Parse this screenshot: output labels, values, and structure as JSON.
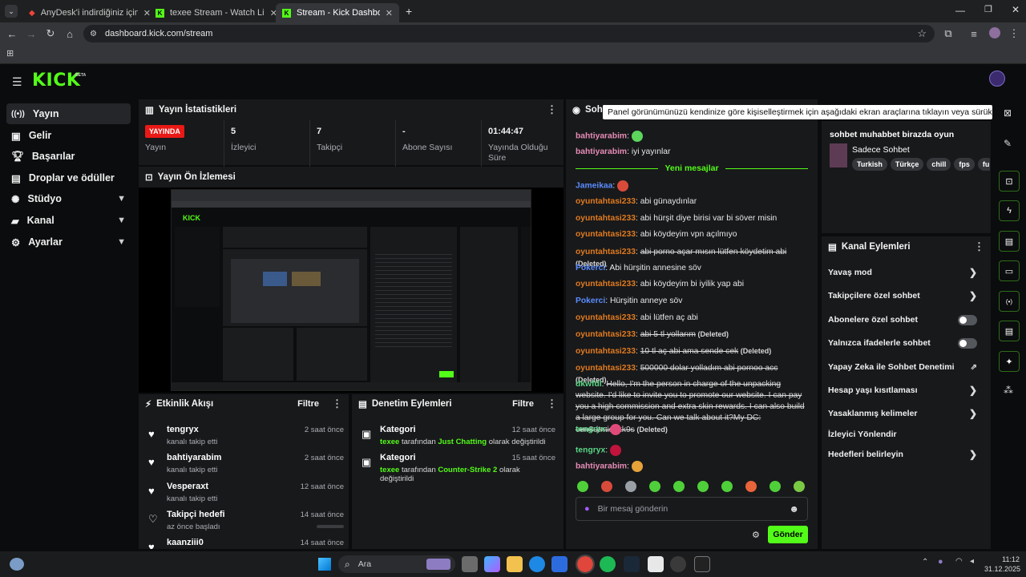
{
  "browser": {
    "tabs": [
      {
        "title": "AnyDesk'i indirdiğiniz için teşekk",
        "active": false
      },
      {
        "title": "texee Stream - Watch Live on Ki",
        "active": false
      },
      {
        "title": "Stream - Kick Dashboard",
        "active": true
      }
    ],
    "url": "dashboard.kick.com/stream"
  },
  "header": {
    "logo": "KICK",
    "beta": "BETA"
  },
  "sidebar": {
    "items": [
      {
        "label": "Yayın",
        "icon": "broadcast-icon",
        "active": true
      },
      {
        "label": "Gelir",
        "icon": "revenue-icon"
      },
      {
        "label": "Başarılar",
        "icon": "trophy-icon"
      },
      {
        "label": "Droplar ve ödüller",
        "icon": "gift-icon"
      },
      {
        "label": "Stüdyo",
        "icon": "studio-icon",
        "expand": true
      },
      {
        "label": "Kanal",
        "icon": "channel-icon",
        "expand": true
      },
      {
        "label": "Ayarlar",
        "icon": "settings-icon",
        "expand": true
      }
    ]
  },
  "stats": {
    "title": "Yayın İstatistikleri",
    "badge": "YAYINDA",
    "items": [
      {
        "label": "Yayın",
        "value": ""
      },
      {
        "label": "İzleyici",
        "value": "5"
      },
      {
        "label": "Takipçi",
        "value": "7"
      },
      {
        "label": "Abone Sayısı",
        "value": "-"
      },
      {
        "label": "Yayında Olduğu Süre",
        "value": "01:44:47"
      }
    ]
  },
  "preview": {
    "title": "Yayın Ön İzlemesi"
  },
  "activity": {
    "title": "Etkinlik Akışı",
    "filter": "Filtre",
    "items": [
      {
        "name": "tengryx",
        "desc": "kanalı takip etti",
        "time": "2 saat önce",
        "icon": "heart"
      },
      {
        "name": "bahtiyarabim",
        "desc": "kanalı takip etti",
        "time": "2 saat önce",
        "icon": "heart"
      },
      {
        "name": "Vesperaxt",
        "desc": "kanalı takip etti",
        "time": "12 saat önce",
        "icon": "heart"
      },
      {
        "name": "Takipçi hedefi",
        "desc": "az önce başladı",
        "time": "14 saat önce",
        "icon": "heart-outline"
      },
      {
        "name": "kaanziii0",
        "desc": "",
        "time": "14 saat önce",
        "icon": "heart"
      }
    ]
  },
  "moderation": {
    "title": "Denetim Eylemleri",
    "filter": "Filtre",
    "items": [
      {
        "title": "Kategori",
        "time": "12 saat önce",
        "user": "texee",
        "mid": "tarafından",
        "cat": "Just Chatting",
        "end": "olarak değiştirildi"
      },
      {
        "title": "Kategori",
        "time": "15 saat önce",
        "user": "texee",
        "mid": "tarafından",
        "cat": "Counter-Strike 2",
        "end": "olarak değiştirildi"
      }
    ]
  },
  "chat": {
    "title": "Sohbet",
    "tooltip": "Panel görünümünüzü kendinize göre kişiselleştirmek için aşağıdaki ekran araçlarına tıklayın veya sürükleyin",
    "new_messages": "Yeni mesajlar",
    "deleted": "(Deleted)",
    "messages": [
      {
        "user": "bahtiyarabim",
        "cls": "u-bh",
        "text": "",
        "emote": "#5cd65c"
      },
      {
        "user": "bahtiyarabim",
        "cls": "u-bh",
        "text": "iyi yayınlar"
      },
      {
        "user": "Jameikaa",
        "cls": "u-bl",
        "text": "",
        "emote": "#d84b3a"
      },
      {
        "user": "oyuntahtasi233",
        "cls": "u-or",
        "text": "abi günaydınlar"
      },
      {
        "user": "oyuntahtasi233",
        "cls": "u-or",
        "text": "abi hürşit diye birisi var bi söver misin"
      },
      {
        "user": "oyuntahtasi233",
        "cls": "u-or",
        "text": "abi köydeyim vpn açılmıyo"
      },
      {
        "user": "oyuntahtasi233",
        "cls": "u-or",
        "text": "abi porno açar mısın lütfen köydetim abi",
        "deleted": true
      },
      {
        "user": "Pokerci",
        "cls": "u-bl",
        "text": "Abi hürşitin annesine söv"
      },
      {
        "user": "oyuntahtasi233",
        "cls": "u-or",
        "text": "abi köydeyim bi iyilik yap abi"
      },
      {
        "user": "Pokerci",
        "cls": "u-bl",
        "text": "Hürşitin anneye söv"
      },
      {
        "user": "oyuntahtasi233",
        "cls": "u-or",
        "text": "abi lütfen aç abi"
      },
      {
        "user": "oyuntahtasi233",
        "cls": "u-or",
        "text": "abi 5 tl yollarım",
        "deleted": true
      },
      {
        "user": "oyuntahtasi233",
        "cls": "u-or",
        "text": "10 tl aç abi ama sende cek",
        "deleted": true
      },
      {
        "user": "oyuntahtasi233",
        "cls": "u-or",
        "text": "500000 dolar yolladım abi pornoo acc",
        "deleted": true
      },
      {
        "user": "dkwfdl",
        "cls": "u-gr",
        "text": "Hello, I'm the person in charge of the unpacking website. I'd like to invite you to promote our website. I can pay you a high commission and extra skin rewards. I can also build a large group for you. Can we talk about it?My DC: cen8dtmis9kk9s",
        "deleted": true
      },
      {
        "user": "tengryx",
        "cls": "u-gr",
        "text": "",
        "emote": "#e04a7a"
      },
      {
        "user": "tengryx",
        "cls": "u-gr",
        "text": "",
        "emote": "#c0143c"
      },
      {
        "user": "bahtiyarabim",
        "cls": "u-bh",
        "text": "",
        "emote": "#e8a23a"
      }
    ],
    "emotes": [
      "#4fcf3a",
      "#d84b3a",
      "#9aa0a6",
      "#4fcf3a",
      "#4fcf3a",
      "#4fcf3a",
      "#4fcf3a",
      "#e8643a",
      "#4fcf3a",
      "#7ac943"
    ],
    "input_placeholder": "Bir mesaj gönderin",
    "send": "Gönder"
  },
  "stream_info": {
    "title": "sohbet muhabbet birazda oyun",
    "category": "Sadece Sohbet",
    "tags": [
      "Turkish",
      "Türkçe",
      "chill",
      "fps",
      "fu"
    ]
  },
  "channel_actions": {
    "title": "Kanal Eylemleri",
    "items": [
      {
        "label": "Yavaş mod",
        "control": "chevron"
      },
      {
        "label": "Takipçilere özel sohbet",
        "control": "chevron"
      },
      {
        "label": "Abonelere özel sohbet",
        "control": "toggle"
      },
      {
        "label": "Yalnızca ifadelerle sohbet",
        "control": "toggle"
      },
      {
        "label": "Yapay Zeka ile Sohbet Denetimi",
        "control": "external"
      },
      {
        "label": "Hesap yaşı kısıtlaması",
        "control": "chevron"
      },
      {
        "label": "Yasaklanmış kelimeler",
        "control": "chevron"
      },
      {
        "label": "İzleyici Yönlendir",
        "control": "none"
      },
      {
        "label": "Hedefleri belirleyin",
        "control": "chevron"
      }
    ]
  },
  "taskbar": {
    "search": "Ara",
    "time": "11:12",
    "date": "31.12.2025"
  }
}
